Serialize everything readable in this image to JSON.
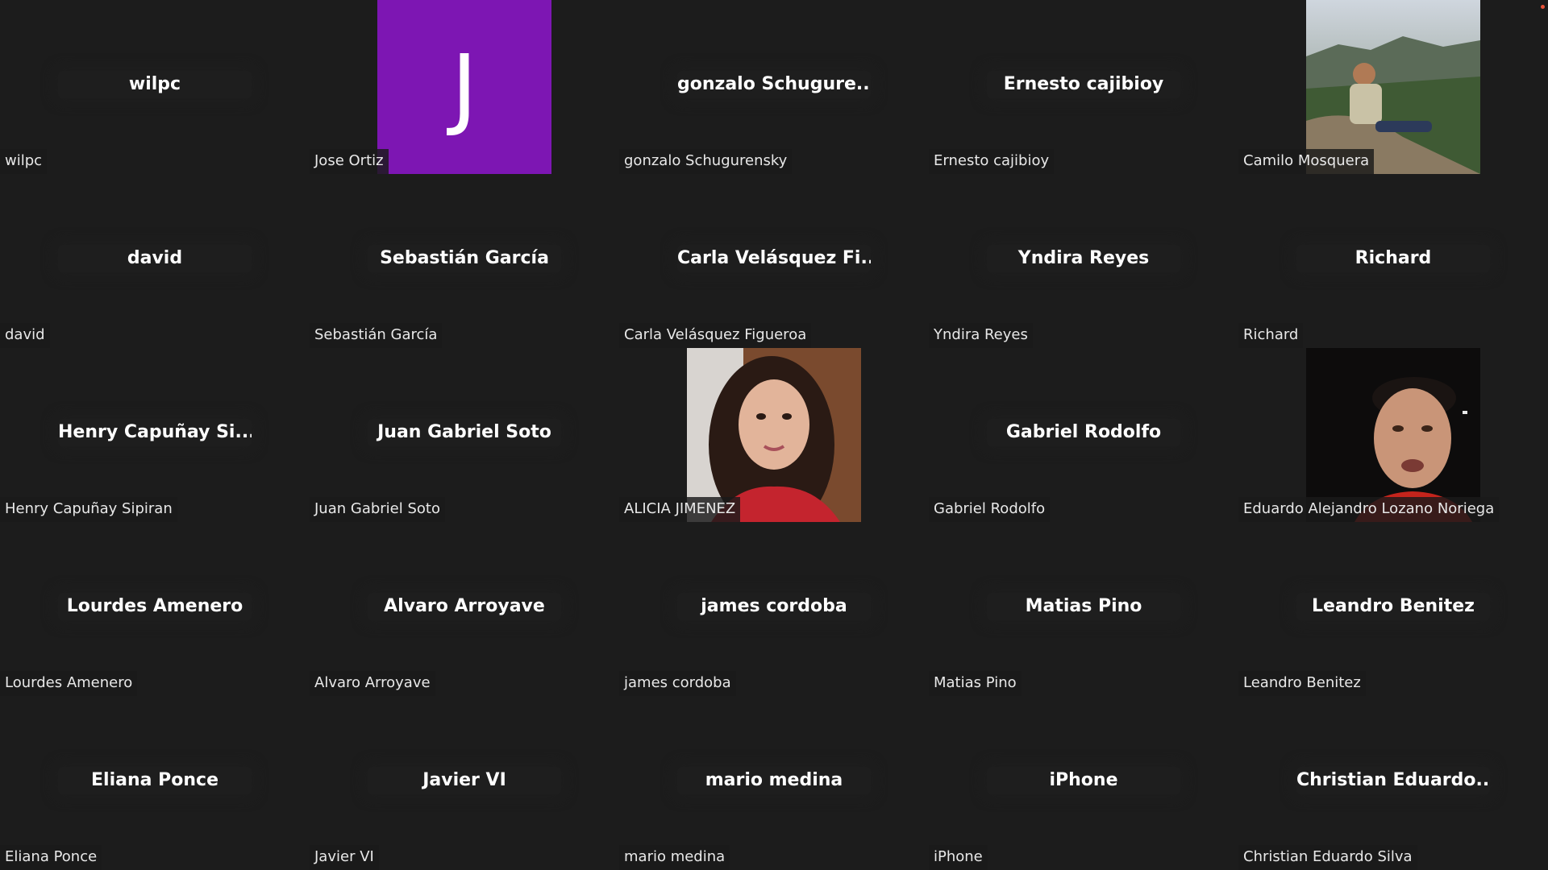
{
  "app": {
    "status_dot_color": "#e8533a"
  },
  "participants": [
    {
      "center_name": "wilpc",
      "label": "wilpc",
      "video": null
    },
    {
      "center_name": "",
      "label": "Jose Ortiz",
      "video": "avatar",
      "avatar_letter": "J",
      "avatar_color": "#7d16b3"
    },
    {
      "center_name": "gonzalo  Schugure...",
      "label": "gonzalo Schugurensky",
      "video": null
    },
    {
      "center_name": "Ernesto cajibioy",
      "label": "Ernesto cajibioy",
      "video": null
    },
    {
      "center_name": "",
      "label": "Camilo Mosquera",
      "video": "landscape-photo"
    },
    {
      "center_name": "david",
      "label": "david",
      "video": null
    },
    {
      "center_name": "Sebastián García",
      "label": "Sebastián García",
      "video": null
    },
    {
      "center_name": "Carla  Velásquez  Fi...",
      "label": "Carla Velásquez Figueroa",
      "video": null
    },
    {
      "center_name": "Yndira Reyes",
      "label": "Yndira Reyes",
      "video": null
    },
    {
      "center_name": "Richard",
      "label": "Richard",
      "video": null
    },
    {
      "center_name": "Henry  Capuñay  Si...",
      "label": "Henry Capuñay Sipiran",
      "video": null
    },
    {
      "center_name": "Juan Gabriel Soto",
      "label": "Juan Gabriel Soto",
      "video": null
    },
    {
      "center_name": "",
      "label": "ALICIA JIMENEZ",
      "video": "portrait-woman"
    },
    {
      "center_name": "Gabriel Rodolfo",
      "label": "Gabriel Rodolfo",
      "video": null
    },
    {
      "center_name": "",
      "label": "Eduardo Alejandro Lozano Noriega",
      "video": "webcam-man"
    },
    {
      "center_name": "Lourdes Amenero",
      "label": "Lourdes Amenero",
      "video": null
    },
    {
      "center_name": "Alvaro Arroyave",
      "label": "Alvaro Arroyave",
      "video": null
    },
    {
      "center_name": "james cordoba",
      "label": "james cordoba",
      "video": null
    },
    {
      "center_name": "Matias Pino",
      "label": "Matias Pino",
      "video": null
    },
    {
      "center_name": "Leandro Benitez",
      "label": "Leandro Benitez",
      "video": null
    },
    {
      "center_name": "Eliana Ponce",
      "label": "Eliana Ponce",
      "video": null
    },
    {
      "center_name": "Javier VI",
      "label": "Javier VI",
      "video": null
    },
    {
      "center_name": "mario medina",
      "label": "mario medina",
      "video": null
    },
    {
      "center_name": "iPhone",
      "label": "iPhone",
      "video": null
    },
    {
      "center_name": "Christian  Eduardo...",
      "label": "Christian Eduardo Silva",
      "video": null
    }
  ]
}
